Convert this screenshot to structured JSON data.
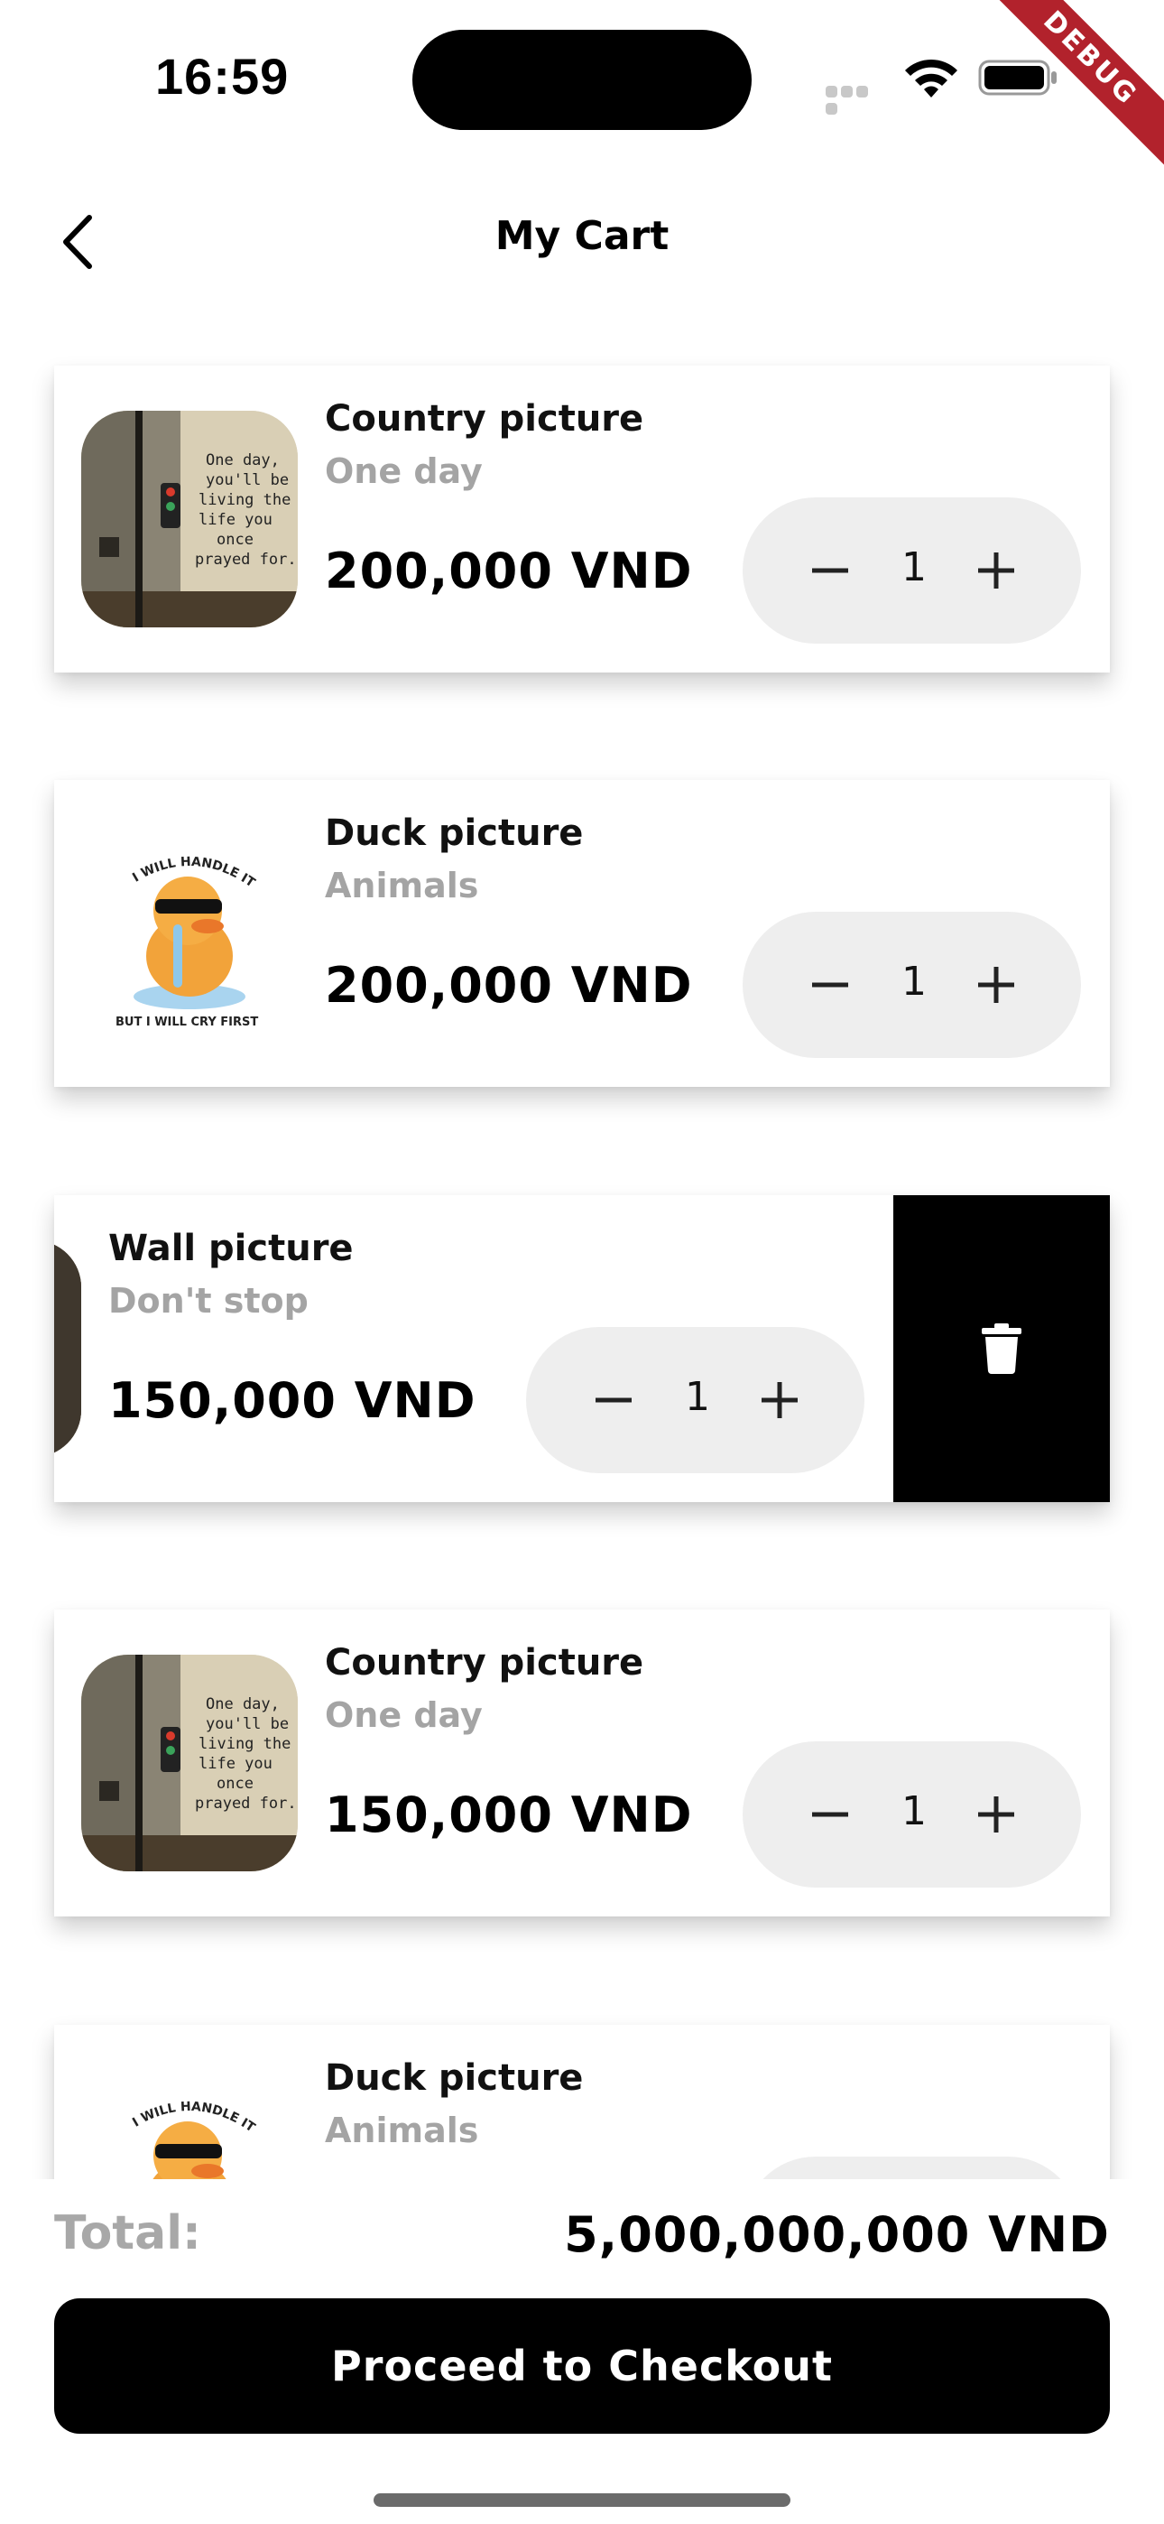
{
  "status_bar": {
    "time": "16:59",
    "debug_label": "DEBUG"
  },
  "app_bar": {
    "title": "My Cart",
    "back_icon": "chevron-left-icon"
  },
  "cart": {
    "items": [
      {
        "name": "Country picture",
        "subtitle": "One day",
        "price": "200,000 VND",
        "quantity": "1",
        "thumbnail": "country-picture",
        "thumbnail_text": "One day, you'll be living the life you once prayed for."
      },
      {
        "name": "Duck picture",
        "subtitle": "Animals",
        "price": "200,000 VND",
        "quantity": "1",
        "thumbnail": "duck-picture",
        "thumbnail_text": "I WILL HANDLE IT BUT I WILL CRY FIRST"
      },
      {
        "name": "Wall picture",
        "subtitle": "Don't stop",
        "price": "150,000 VND",
        "quantity": "1",
        "thumbnail": "wall-picture",
        "swiped_open": true,
        "delete_icon": "trash-icon"
      },
      {
        "name": "Country picture",
        "subtitle": "One day",
        "price": "150,000 VND",
        "quantity": "1",
        "thumbnail": "country-picture",
        "thumbnail_text": "One day, you'll be living the life you once prayed for."
      },
      {
        "name": "Duck picture",
        "subtitle": "Animals",
        "thumbnail": "duck-picture",
        "thumbnail_text": "I WILL HANDLE IT"
      }
    ]
  },
  "footer": {
    "total_label": "Total:",
    "total_value": "5,000,000,000 VND",
    "checkout_label": "Proceed to Checkout"
  },
  "icons": {
    "minus": "minus-icon",
    "plus": "plus-icon",
    "delete": "trash-icon"
  },
  "colors": {
    "primary": "#000000",
    "subtitle_gray": "#a4a4a4",
    "stepper_bg": "#eeeeee",
    "debug_ribbon": "#b2222c"
  }
}
